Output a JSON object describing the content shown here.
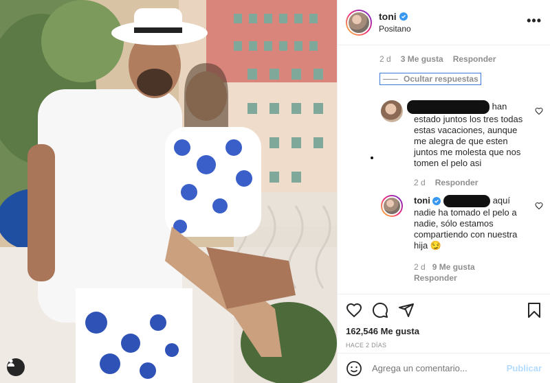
{
  "header": {
    "username": "toni",
    "location": "Positano",
    "more_glyph": "•••"
  },
  "comments": {
    "top_meta": {
      "time": "2 d",
      "likes": "3 Me gusta",
      "reply": "Responder"
    },
    "hide_replies": "Ocultar respuestas",
    "reply1": {
      "text": "han estado juntos los tres todas estas vacaciones, aunque me alegra de que esten juntos me molesta que nos tomen el pelo asi",
      "meta": {
        "time": "2 d",
        "reply": "Responder"
      }
    },
    "reply2": {
      "username": "toni",
      "text": "aquí nadie ha tomado el pelo a nadie, sólo estamos compartiendo con nuestra hija 😏",
      "meta": {
        "time": "2 d",
        "likes": "9 Me gusta",
        "reply": "Responder"
      }
    }
  },
  "actions": {
    "likes": "162,546 Me gusta",
    "time_ago": "HACE 2 DÍAS"
  },
  "composer": {
    "placeholder": "Agrega un comentario...",
    "post_label": "Publicar"
  },
  "colors": {
    "accent": "#3897f0",
    "post_disabled": "#b3dbff",
    "meta_gray": "#8e8e8e"
  },
  "icons": [
    "heart-icon",
    "comment-icon",
    "share-icon",
    "bookmark-icon",
    "emoji-icon",
    "verified-icon",
    "user-tag-icon",
    "more-icon"
  ]
}
